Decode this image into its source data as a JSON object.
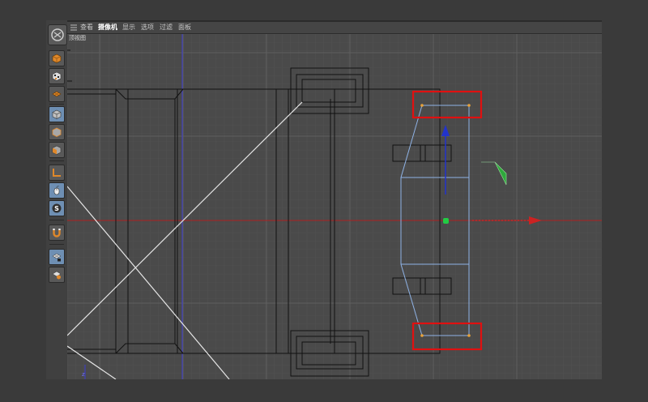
{
  "menubar": {
    "items": [
      {
        "label": "查看"
      },
      {
        "label": "摄像机"
      },
      {
        "label": "显示"
      },
      {
        "label": "选项"
      },
      {
        "label": "过滤"
      },
      {
        "label": "面板"
      }
    ],
    "active_index": 1
  },
  "viewport": {
    "label": "顶视图",
    "axis_colors": {
      "x": "#cc2222",
      "z": "#2233cc",
      "y": "#22cc44",
      "selection_outline": "#e01010",
      "spline": "#8fb3e6"
    }
  },
  "toolbar": {
    "tools": [
      {
        "icon": "cube-icon",
        "active": false
      },
      {
        "icon": "checker-cube-icon",
        "active": false
      },
      {
        "icon": "plane-grid-icon",
        "active": false
      },
      {
        "icon": "cube-select-icon",
        "active": true
      },
      {
        "icon": "cube-edges-icon",
        "active": false
      },
      {
        "icon": "cube-faces-icon",
        "active": false
      },
      {
        "icon": "axis-l-icon",
        "active": false
      },
      {
        "icon": "mouse-icon",
        "active": true
      },
      {
        "icon": "snap-s-icon",
        "active": false
      },
      {
        "icon": "magnet-icon",
        "active": false
      },
      {
        "icon": "grid-lock-icon",
        "active": true
      },
      {
        "icon": "grid-sphere-icon",
        "active": false
      }
    ]
  }
}
